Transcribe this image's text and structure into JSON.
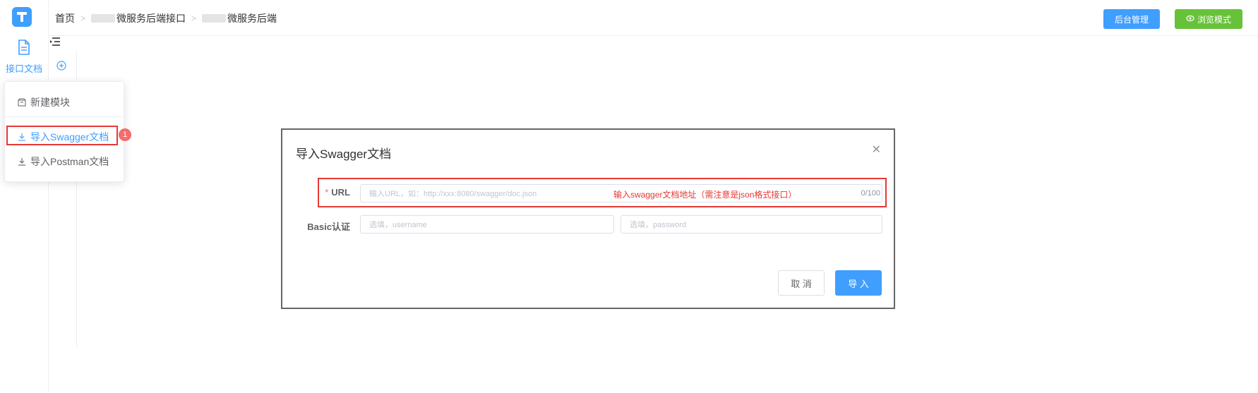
{
  "header": {
    "breadcrumbs": [
      "首页",
      "微服务后端接口",
      "微服务后端"
    ],
    "admin_button": "后台管理",
    "browse_button": "浏览模式"
  },
  "rail": {
    "item_label": "接口文档"
  },
  "dropdown": {
    "items": [
      "新建模块",
      "导入Swagger文档",
      "导入Postman文档"
    ]
  },
  "step_badge": "1",
  "modal": {
    "title": "导入Swagger文档",
    "url_required_mark": "*",
    "url_label": "URL",
    "url_placeholder": "输入URL，如：http://xxx:8080/swagger/doc.json",
    "url_note": "输入swagger文档地址（需注意是json格式接口）",
    "url_counter": "0/100",
    "basic_label": "Basic认证",
    "username_placeholder": "选填，username",
    "password_placeholder": "选填，password",
    "cancel_button": "取 消",
    "import_button": "导 入"
  },
  "colors": {
    "primary": "#409eff",
    "success": "#67c23a",
    "annotation_red": "#e53935"
  }
}
